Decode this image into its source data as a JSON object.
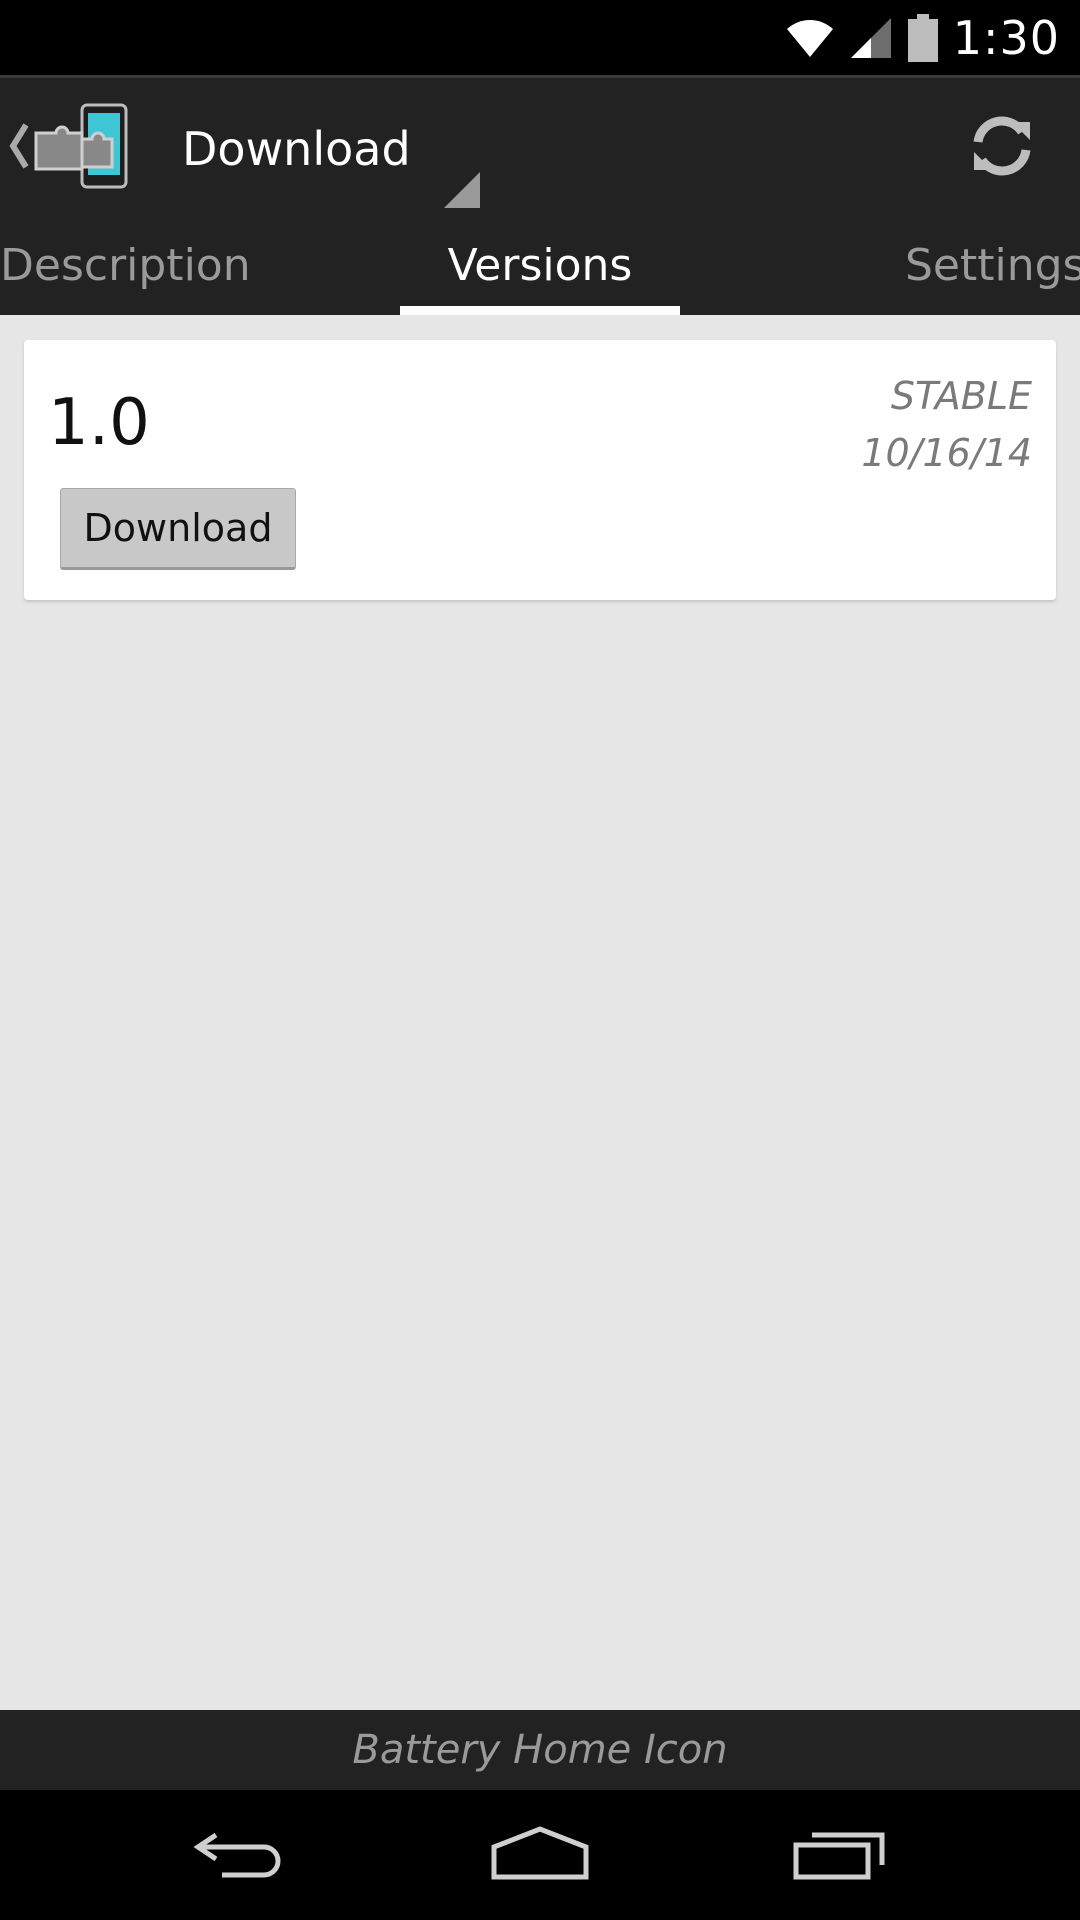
{
  "status_bar": {
    "time": "1:30",
    "icons": [
      "wifi-icon",
      "signal-icon",
      "battery-icon"
    ]
  },
  "action_bar": {
    "app_icon": "xposed-puzzle-icon",
    "spinner_label": "Download",
    "refresh_icon": "refresh-icon"
  },
  "tabs": [
    {
      "label": "Description",
      "selected": false
    },
    {
      "label": "Versions",
      "selected": true
    },
    {
      "label": "Settings",
      "selected": false
    }
  ],
  "version": {
    "number": "1.0",
    "status": "STABLE",
    "date": "10/16/14",
    "download_label": "Download"
  },
  "footer": {
    "module_name": "Battery Home Icon"
  },
  "nav_bar": {
    "icons": [
      "back-icon",
      "home-icon",
      "recents-icon"
    ]
  },
  "colors": {
    "bar_background": "#222222",
    "accent_teal": "#3fc6d4",
    "content_background": "#e6e6e6"
  }
}
